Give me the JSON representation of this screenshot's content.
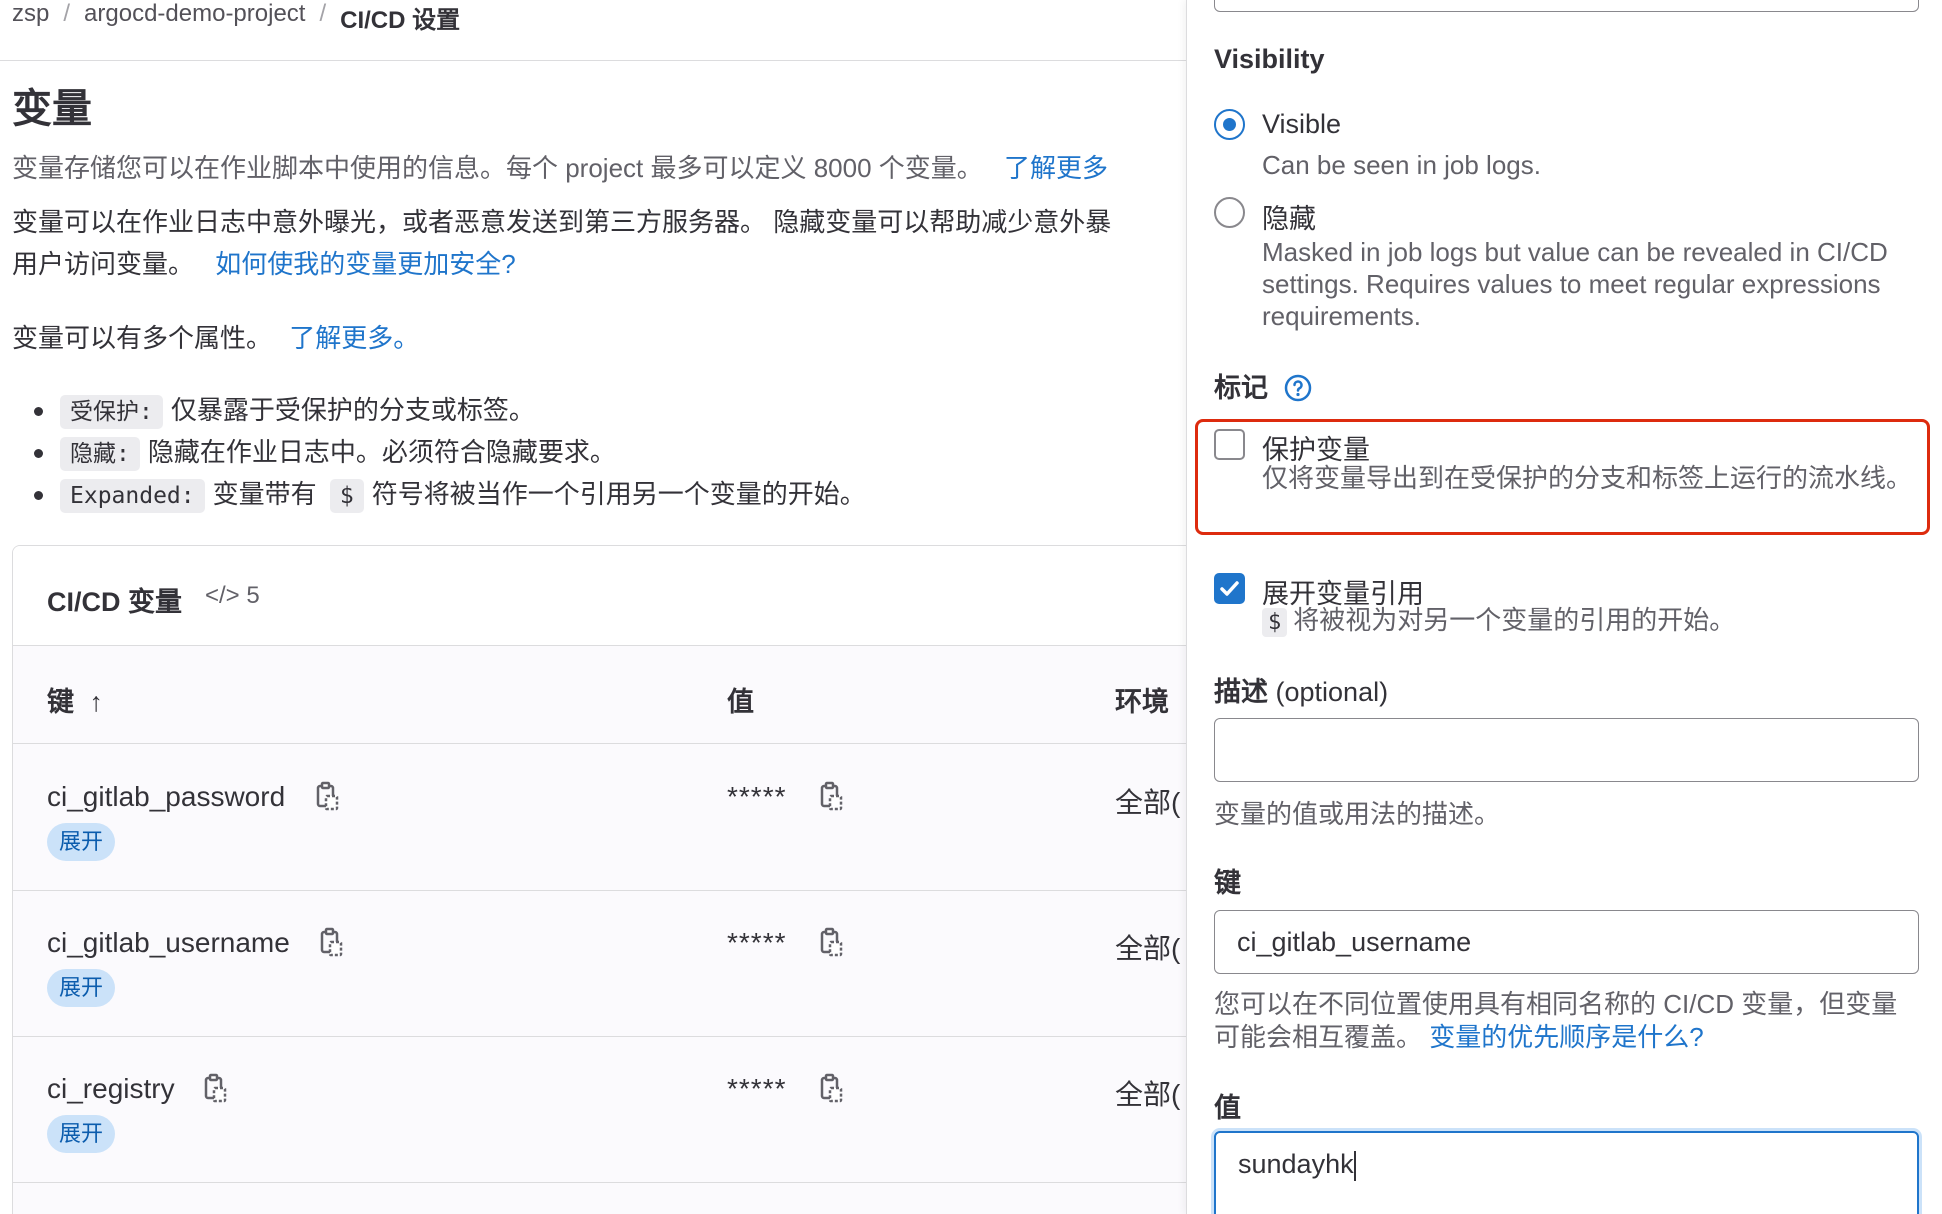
{
  "breadcrumb": [
    "zsp",
    "argocd-demo-project",
    "CI/CD 设置"
  ],
  "page": {
    "title": "变量",
    "intro": "变量存储您可以在作业脚本中使用的信息。每个 project 最多可以定义 8000 个变量。",
    "intro_link": "了解更多",
    "security_line1": "变量可以在作业日志中意外曝光，或者恶意发送到第三方服务器。 隐藏变量可以帮助减少意外暴",
    "security_line2": "用户访问变量。",
    "security_link": "如何使我的变量更加安全?",
    "attrs_text": "变量可以有多个属性。",
    "attrs_link": "了解更多。",
    "bullets": [
      {
        "code": "受保护:",
        "text": "仅暴露于受保护的分支或标签。"
      },
      {
        "code": "隐藏:",
        "text": "隐藏在作业日志中。必须符合隐藏要求。"
      },
      {
        "code": "Expanded:",
        "text_before": "变量带有",
        "symbol": "$",
        "text_after": "符号将被当作一个引用另一个变量的开始。"
      }
    ]
  },
  "variables_card": {
    "title": "CI/CD 变量",
    "count": "5",
    "columns": {
      "key": "键",
      "value": "值",
      "environment": "环境"
    },
    "rows": [
      {
        "key": "ci_gitlab_password",
        "value": "*****",
        "env": "全部(",
        "badge": "展开"
      },
      {
        "key": "ci_gitlab_username",
        "value": "*****",
        "env": "全部(",
        "badge": "展开"
      },
      {
        "key": "ci_registry",
        "value": "*****",
        "env": "全部(",
        "badge": "展开"
      }
    ]
  },
  "drawer": {
    "visibility_label": "Visibility",
    "visible_title": "Visible",
    "visible_help": "Can be seen in job logs.",
    "masked_title": "隐藏",
    "masked_help": "Masked in job logs but value can be revealed in CI/CD settings. Requires values to meet regular expressions requirements.",
    "flags_label": "标记",
    "protect_title": "保护变量",
    "protect_help": "仅将变量导出到在受保护的分支和标签上运行的流水线。",
    "expand_title": "展开变量引用",
    "expand_symbol": "$",
    "expand_help": "将被视为对另一个变量的引用的开始。",
    "description_label": "描述",
    "description_optional": "(optional)",
    "description_value": "",
    "description_help": "变量的值或用法的描述。",
    "key_label": "键",
    "key_value": "ci_gitlab_username",
    "key_help": "您可以在不同位置使用具有相同名称的 CI/CD 变量，但变量可能会相互覆盖。",
    "key_help_link": "变量的优先顺序是什么?",
    "value_label": "值",
    "value_value": "sundayhk"
  },
  "state": {
    "visibility_selected": "Visible",
    "protect_checked": false,
    "expand_checked": true
  },
  "colors": {
    "link": "#1f75cb",
    "highlight": "#dd2b0e",
    "badge_bg": "#cbe2f9",
    "badge_text": "#0b5cad"
  }
}
